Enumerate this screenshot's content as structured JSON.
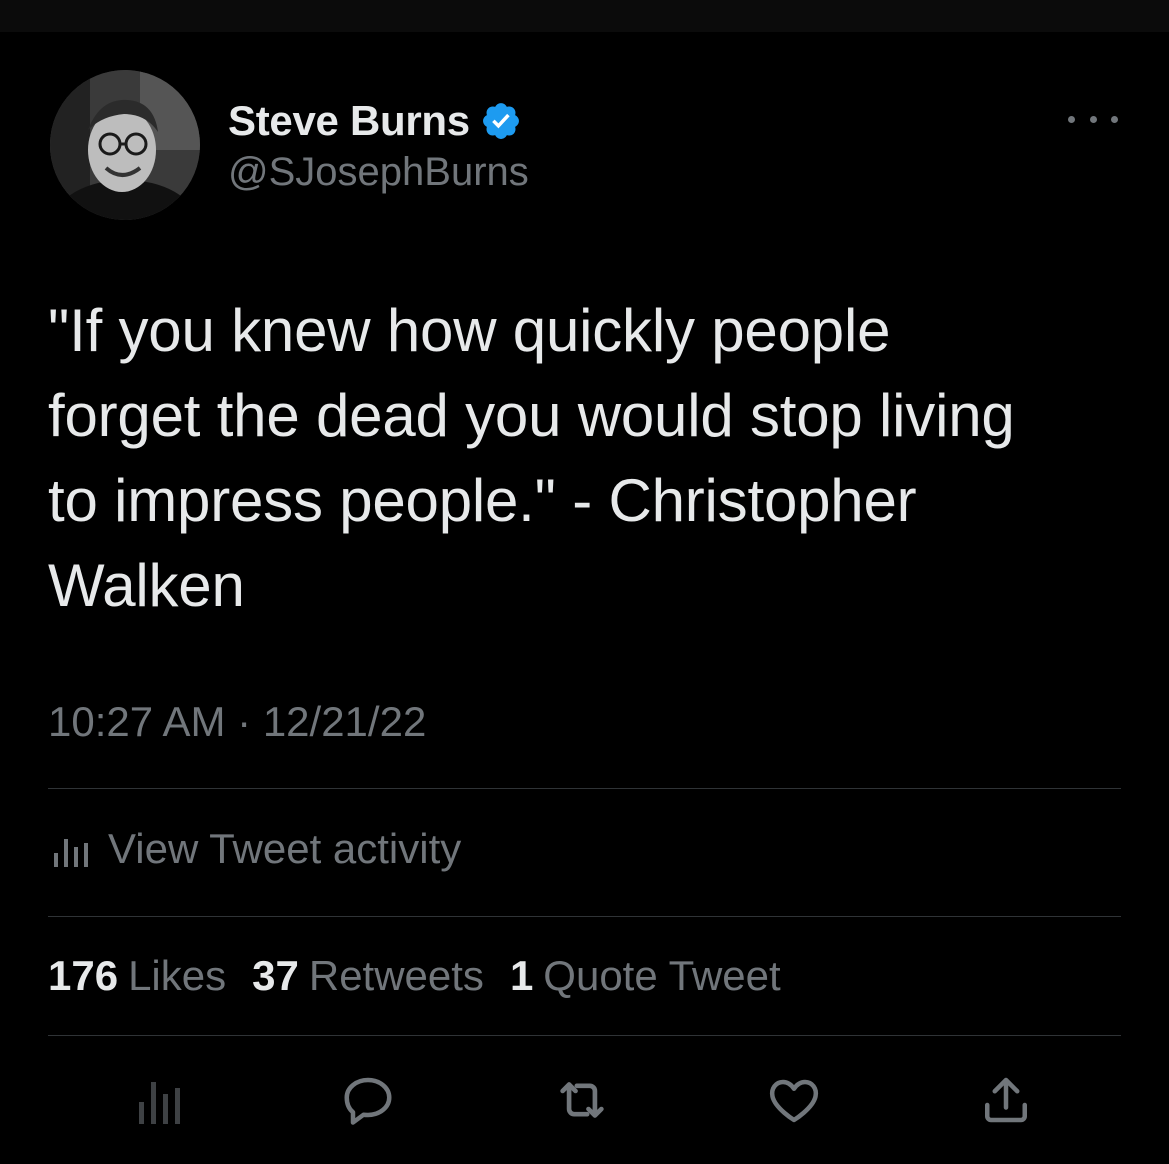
{
  "author": {
    "display_name": "Steve Burns",
    "handle": "@SJosephBurns",
    "verified": true,
    "verified_icon": "verified-badge-icon"
  },
  "tweet": {
    "text": "\"If you knew how quickly people\nforget the dead you would stop living\nto impress people.\" - Christopher\nWalken",
    "time": "10:27 AM",
    "separator": "·",
    "date": "12/21/22"
  },
  "activity": {
    "label": "View Tweet activity",
    "icon": "bar-chart-icon"
  },
  "stats": [
    {
      "count": "176",
      "label": "Likes"
    },
    {
      "count": "37",
      "label": "Retweets"
    },
    {
      "count": "1",
      "label": "Quote Tweet"
    }
  ],
  "action_icons": [
    "analytics-icon",
    "reply-icon",
    "retweet-icon",
    "like-icon",
    "share-icon"
  ],
  "colors": {
    "background": "#000000",
    "primary_text": "#e7e9ea",
    "secondary_text": "#71767b",
    "divider": "#2f3336",
    "verified": "#1d9bf0"
  }
}
